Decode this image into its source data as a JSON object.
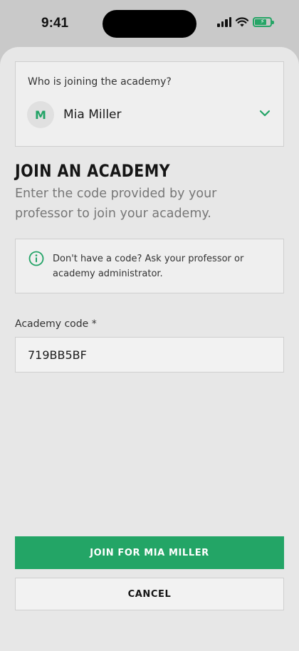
{
  "status_bar": {
    "time": "9:41",
    "battery_color": "#25a566"
  },
  "user_picker": {
    "label": "Who is joining the academy?",
    "avatar_initial": "M",
    "selected_user": "Mia Miller",
    "chevron_icon": "chevron-down-icon",
    "accent_color": "#22a366"
  },
  "header": {
    "title": "JOIN AN ACADEMY",
    "subtitle": "Enter the code provided by your professor to join your academy."
  },
  "info": {
    "icon": "info-icon",
    "text": "Don't have a code? Ask your professor or academy administrator."
  },
  "form": {
    "code_label": "Academy code *",
    "code_value": "719BB5BF"
  },
  "actions": {
    "join_label": "JOIN FOR MIA MILLER",
    "cancel_label": "CANCEL",
    "primary_color": "#23a566"
  }
}
